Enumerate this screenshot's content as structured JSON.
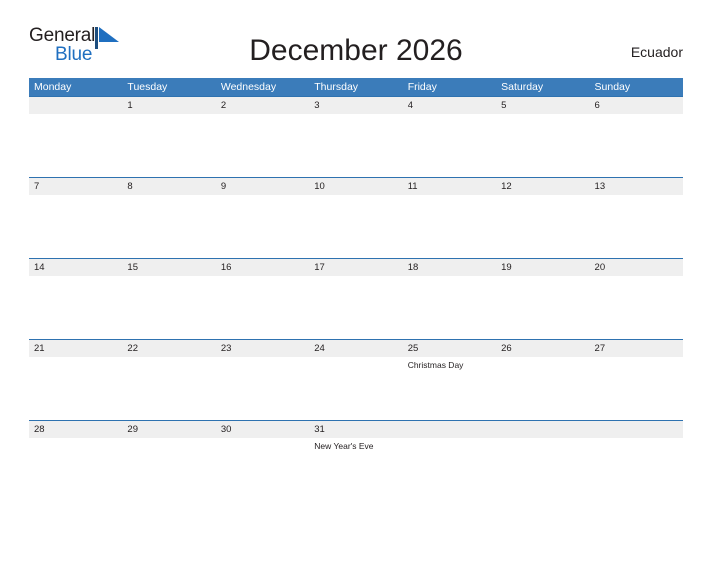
{
  "brand": {
    "name_part1": "General",
    "name_part2": "Blue",
    "flag_icon": "blue-triangle-flag-icon",
    "colors": {
      "dark": "#231f20",
      "blue": "#1f6fc0",
      "header_blue": "#3b7cba",
      "row_line_blue": "#2e72b0",
      "row_bg": "#efefef"
    }
  },
  "header": {
    "title": "December 2026",
    "locale": "Ecuador"
  },
  "calendar": {
    "weekdays": [
      "Monday",
      "Tuesday",
      "Wednesday",
      "Thursday",
      "Friday",
      "Saturday",
      "Sunday"
    ],
    "weeks": [
      {
        "days": [
          {
            "date": "",
            "events": []
          },
          {
            "date": "1",
            "events": []
          },
          {
            "date": "2",
            "events": []
          },
          {
            "date": "3",
            "events": []
          },
          {
            "date": "4",
            "events": []
          },
          {
            "date": "5",
            "events": []
          },
          {
            "date": "6",
            "events": []
          }
        ]
      },
      {
        "days": [
          {
            "date": "7",
            "events": []
          },
          {
            "date": "8",
            "events": []
          },
          {
            "date": "9",
            "events": []
          },
          {
            "date": "10",
            "events": []
          },
          {
            "date": "11",
            "events": []
          },
          {
            "date": "12",
            "events": []
          },
          {
            "date": "13",
            "events": []
          }
        ]
      },
      {
        "days": [
          {
            "date": "14",
            "events": []
          },
          {
            "date": "15",
            "events": []
          },
          {
            "date": "16",
            "events": []
          },
          {
            "date": "17",
            "events": []
          },
          {
            "date": "18",
            "events": []
          },
          {
            "date": "19",
            "events": []
          },
          {
            "date": "20",
            "events": []
          }
        ]
      },
      {
        "days": [
          {
            "date": "21",
            "events": []
          },
          {
            "date": "22",
            "events": []
          },
          {
            "date": "23",
            "events": []
          },
          {
            "date": "24",
            "events": []
          },
          {
            "date": "25",
            "events": [
              "Christmas Day"
            ]
          },
          {
            "date": "26",
            "events": []
          },
          {
            "date": "27",
            "events": []
          }
        ]
      },
      {
        "days": [
          {
            "date": "28",
            "events": []
          },
          {
            "date": "29",
            "events": []
          },
          {
            "date": "30",
            "events": []
          },
          {
            "date": "31",
            "events": [
              "New Year's Eve"
            ]
          },
          {
            "date": "",
            "events": []
          },
          {
            "date": "",
            "events": []
          },
          {
            "date": "",
            "events": []
          }
        ]
      }
    ]
  }
}
